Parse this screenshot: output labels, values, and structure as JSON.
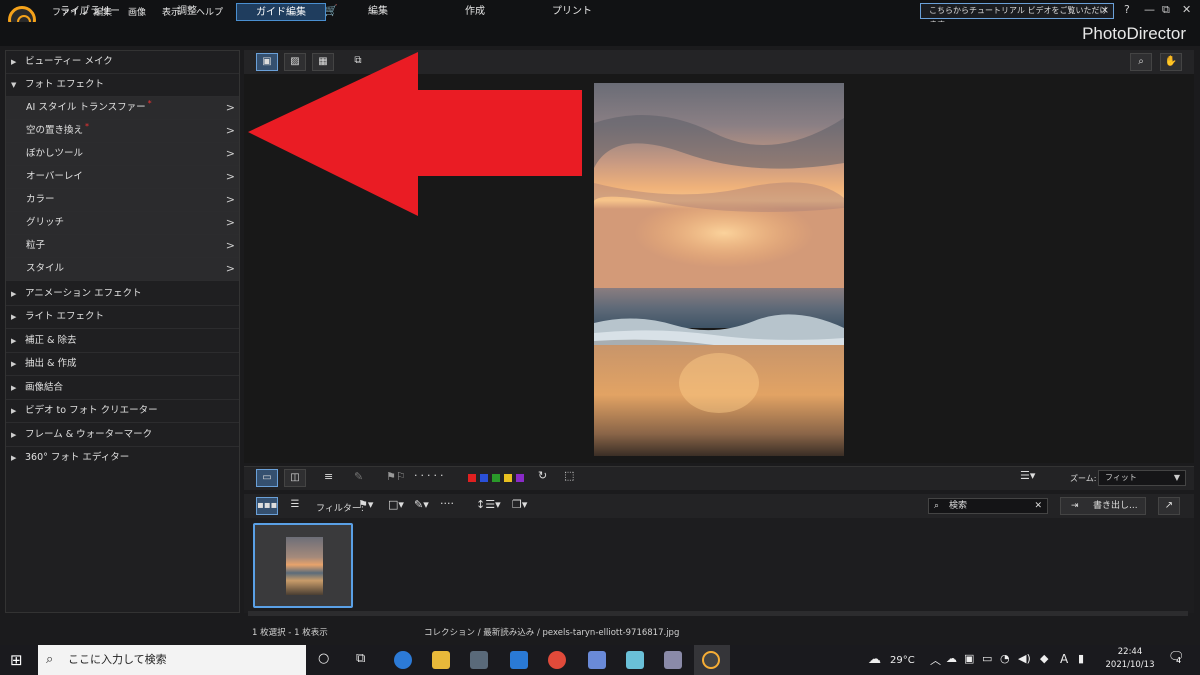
{
  "menu": {
    "items": [
      "ファイル",
      "編集",
      "画像",
      "表示",
      "ヘルプ"
    ]
  },
  "tabs": {
    "library": "ライブラリー",
    "adjust": "調整",
    "guided_edit": "ガイド編集",
    "edit": "編集",
    "create": "作成",
    "print": "プリント"
  },
  "brand": "PhotoDirector",
  "notice": "こちらからチュートリアル ビデオをご覧いただけます。",
  "window_controls": {
    "help": "?",
    "minimize": "—",
    "restore": "⧉",
    "close": "✕"
  },
  "left_panel": {
    "sections": [
      {
        "label": "ビューティー メイク",
        "expanded": false
      },
      {
        "label": "フォト エフェクト",
        "expanded": true
      }
    ],
    "sub_items": [
      {
        "label": "AI スタイル トランスファー",
        "new": true
      },
      {
        "label": "空の置き換え",
        "new": true
      },
      {
        "label": "ぼかしツール",
        "new": false
      },
      {
        "label": "オーバーレイ",
        "new": false
      },
      {
        "label": "カラー",
        "new": false
      },
      {
        "label": "グリッチ",
        "new": false
      },
      {
        "label": "粒子",
        "new": false
      },
      {
        "label": "スタイル",
        "new": false
      }
    ],
    "more_sections": [
      "アニメーション エフェクト",
      "ライト エフェクト",
      "補正 & 除去",
      "抽出 & 作成",
      "画像結合",
      "ビデオ to フォト クリエーター",
      "フレーム & ウォーターマーク",
      "360° フォト エディター"
    ]
  },
  "toolbar": {
    "zoom_label": "ズーム:",
    "zoom_value": "フィット",
    "filter_label": "フィルター:",
    "search_placeholder": "検索",
    "export_label": "書き出し...",
    "color_labels": [
      "#e02020",
      "#2a50d8",
      "#2a9a2a",
      "#e8c020",
      "#8a2ac8"
    ]
  },
  "status": {
    "selection": "1 枚選択 - 1 枚表示",
    "path": "コレクション / 最新読み込み / pexels-taryn-elliott-9716817.jpg"
  },
  "taskbar": {
    "search_placeholder": "ここに入力して検索",
    "weather": "29°C",
    "time": "22:44",
    "date": "2021/10/13",
    "notifications": "4",
    "ime": "A"
  }
}
